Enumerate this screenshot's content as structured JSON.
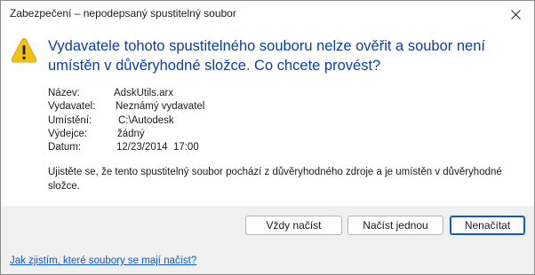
{
  "window": {
    "title": "Zabezpečení – nepodepsaný spustitelný soubor",
    "close_icon": "close-icon"
  },
  "warning_icon": "warning-icon",
  "heading": "Vydavatele tohoto spustitelného souboru nelze ověřit a soubor není umístěn v důvěryhodné složce. Co chcete provést?",
  "details": {
    "name_label": "Název:",
    "name_value": "AdskUtils.arx",
    "publisher_label": "Vydavatel:",
    "publisher_value": "Neznámý vydavatel",
    "location_label": "Umístění:",
    "location_value": "C:\\Autodesk",
    "issuer_label": "Výdejce:",
    "issuer_value": "žádný",
    "date_label": "Datum:",
    "date_value": "12/23/2014  17:00"
  },
  "message": "Ujistěte se, že tento spustitelný soubor pochází z důvěryhodného zdroje a je umístěn v důvěryhodné složce.",
  "buttons": {
    "always_load": "Vždy načíst",
    "load_once": "Načíst jednou",
    "do_not_load": "Nenačítat"
  },
  "help_link": "Jak zjistím, které soubory se mají načíst?",
  "colors": {
    "heading": "#0b3da8",
    "link": "#0b59c4",
    "footer_bg": "#f0f0f0",
    "default_button_border": "#0b5ec0",
    "warning_fill": "#f4c20d"
  }
}
